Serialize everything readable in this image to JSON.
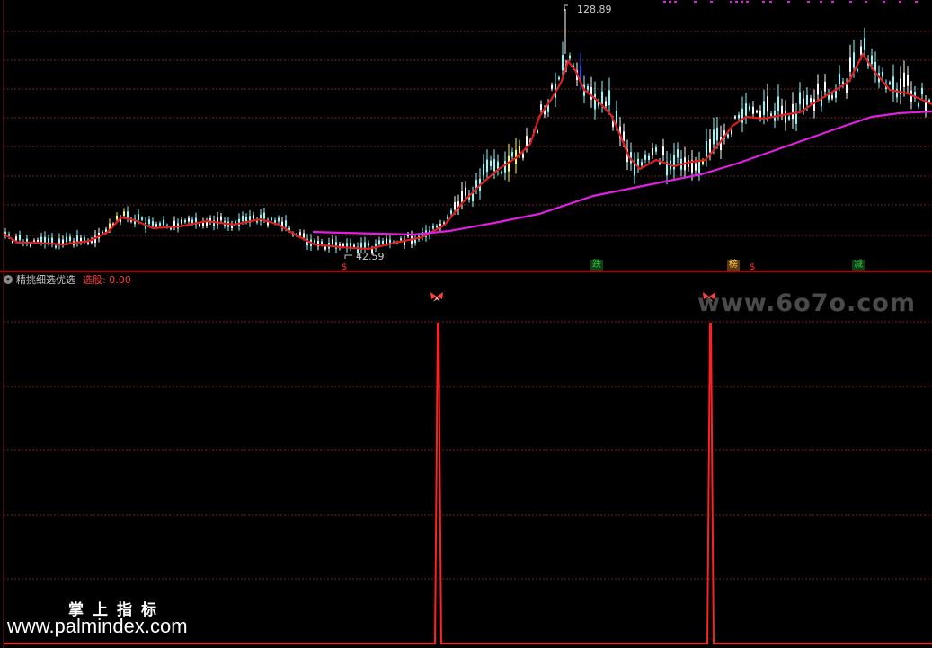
{
  "price_chart": {
    "high_label": "128.89",
    "low_label": "42.59",
    "signal_badges": [
      {
        "text": "跌",
        "color": "#2fbf3f",
        "bg": "#0e3f12"
      },
      {
        "text": "榜",
        "color": "#ffcf3f",
        "bg": "#5a3a0e"
      },
      {
        "text": "减",
        "color": "#2fbf3f",
        "bg": "#0e3f12"
      }
    ],
    "s_marker": "$"
  },
  "indicator": {
    "name": "精挑细选优选",
    "value_label": "选股: 0.00"
  },
  "watermarks": {
    "site": "www.6o7o.com",
    "cn_name": "掌上指标",
    "url": "www.palmindex.com"
  },
  "colors": {
    "background": "#000000",
    "grid": "#7a1f1f",
    "ma_red": "#e01e1e",
    "ma_magenta": "#e020e0",
    "candle_up": "#7fffff",
    "candle_hi": "#ffff33",
    "candle_down": "#2050ff",
    "signal": "#ff2020"
  }
}
